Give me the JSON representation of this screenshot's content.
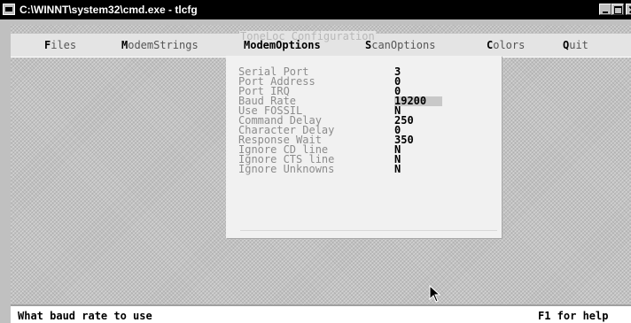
{
  "window": {
    "title": "C:\\WINNT\\system32\\cmd.exe - tlcfg"
  },
  "app": {
    "frame_title": "ToneLoc Configuration"
  },
  "menu": {
    "items": [
      {
        "hotkey": "F",
        "rest": "iles"
      },
      {
        "hotkey": "M",
        "rest": "odemStrings"
      },
      {
        "hotkey": "M",
        "rest": "odemOptions",
        "active": true
      },
      {
        "hotkey": "S",
        "rest": "canOptions"
      },
      {
        "hotkey": "C",
        "rest": "olors"
      },
      {
        "hotkey": "Q",
        "rest": "uit"
      }
    ]
  },
  "modem_options": {
    "items": [
      {
        "label": "Serial Port",
        "value": "3"
      },
      {
        "label": "Port Address",
        "value": "0"
      },
      {
        "label": "Port IRQ",
        "value": "0"
      },
      {
        "label": "Baud Rate",
        "value": "19200",
        "selected": true
      },
      {
        "label": "Use FOSSIL",
        "value": "N"
      },
      {
        "label": "Command Delay",
        "value": "250"
      },
      {
        "label": "Character Delay",
        "value": "0"
      },
      {
        "label": "Response Wait",
        "value": "350"
      },
      {
        "label": "Ignore CD line",
        "value": "N"
      },
      {
        "label": "Ignore CTS line",
        "value": "N"
      },
      {
        "label": "Ignore Unknowns",
        "value": "N"
      }
    ]
  },
  "status": {
    "hint": "What baud rate to use",
    "help": "F1 for help"
  },
  "colors": {
    "selection": "#c8c8c8",
    "background": "#c0c0c0",
    "titlebar": "#000000"
  }
}
